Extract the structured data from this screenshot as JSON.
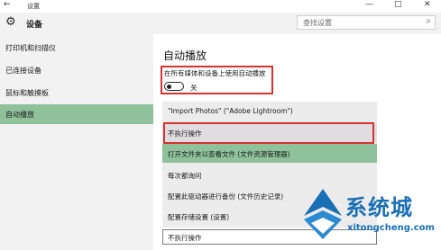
{
  "window": {
    "title": "设置",
    "back_icon": "back-arrow-icon",
    "controls": [
      "—",
      "□",
      "✕"
    ]
  },
  "header": {
    "title": "设备",
    "icon": "gear-icon"
  },
  "search": {
    "placeholder": "查找设置",
    "icon": "search-icon"
  },
  "sidebar": {
    "items": [
      {
        "label": "打印机和扫描仪"
      },
      {
        "label": "已连接设备"
      },
      {
        "label": "鼠标和触摸板"
      },
      {
        "label": "自动播放",
        "active": true
      }
    ]
  },
  "main": {
    "title": "自动播放",
    "toggle": {
      "label": "在所有媒体和设备上使用自动播放",
      "state": "关",
      "on": false
    },
    "options": [
      {
        "label": "\"Import Photos\" (\"Adobe Lightroom\")"
      },
      {
        "label": "不执行操作"
      },
      {
        "label": "打开文件夹以查看文件 (文件资源管理器)"
      },
      {
        "label": "每次都询问"
      },
      {
        "label": "配置此驱动器进行备份 (文件历史记录)"
      },
      {
        "label": "配置存储设置 (设置)"
      }
    ],
    "combo_value": "不执行操作"
  },
  "watermark": {
    "name": "系统城",
    "url": "xitongcheng.com"
  },
  "colors": {
    "accent": "#8fc29b",
    "highlight_border": "#d7322f",
    "sidebar_bg": "#f2f2f2",
    "watermark": "#1b6fb5"
  }
}
